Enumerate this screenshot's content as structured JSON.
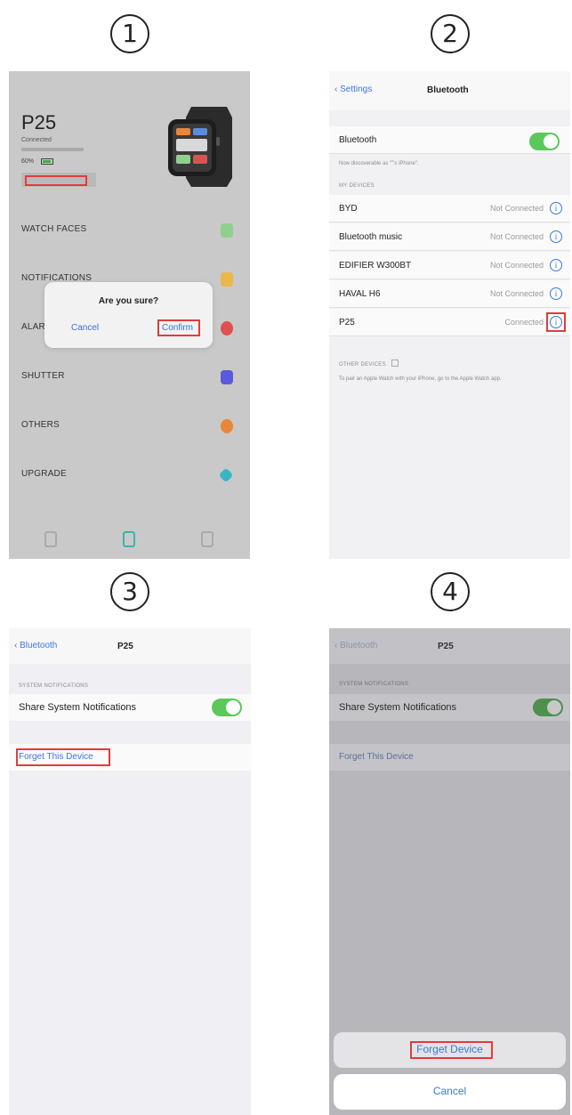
{
  "steps": [
    "1",
    "2",
    "3",
    "4"
  ],
  "panel1": {
    "device_name": "P25",
    "connected_status": "Connected",
    "battery": "60%",
    "menu": [
      "WATCH FACES",
      "NOTIFICATIONS",
      "ALARM",
      "SHUTTER",
      "OTHERS",
      "UPGRADE"
    ],
    "dialog": {
      "title": "Are you sure?",
      "cancel": "Cancel",
      "confirm": "Confirm"
    },
    "colors": {
      "watch_faces": "#8fd08f",
      "notifications": "#e8b84a",
      "alarm": "#e05050",
      "shutter": "#5a5adc",
      "others": "#e8873a",
      "upgrade": "#3ab5c8"
    }
  },
  "panel2": {
    "back": "Settings",
    "title": "Bluetooth",
    "bluetooth_label": "Bluetooth",
    "discoverable_text": "Now discoverable as \"\"'s iPhone\".",
    "my_devices_header": "MY DEVICES",
    "devices": [
      {
        "name": "BYD",
        "status": "Not Connected"
      },
      {
        "name": "Bluetooth music",
        "status": "Not Connected"
      },
      {
        "name": "EDIFIER W300BT",
        "status": "Not Connected"
      },
      {
        "name": "HAVAL H6",
        "status": "Not Connected"
      },
      {
        "name": "P25",
        "status": "Connected"
      }
    ],
    "other_devices_header": "OTHER DEVICES",
    "pairing_text": "To pair an Apple Watch with your iPhone, go to the Apple Watch app."
  },
  "panel3": {
    "back": "Bluetooth",
    "title": "P25",
    "section_header": "SYSTEM NOTIFICATIONS",
    "share_label": "Share System Notifications",
    "forget_label": "Forget This Device"
  },
  "panel4": {
    "back": "Bluetooth",
    "title": "P25",
    "section_header": "SYSTEM NOTIFICATIONS",
    "share_label": "Share System Notifications",
    "forget_label": "Forget This Device",
    "sheet_forget": "Forget Device",
    "sheet_cancel": "Cancel"
  }
}
